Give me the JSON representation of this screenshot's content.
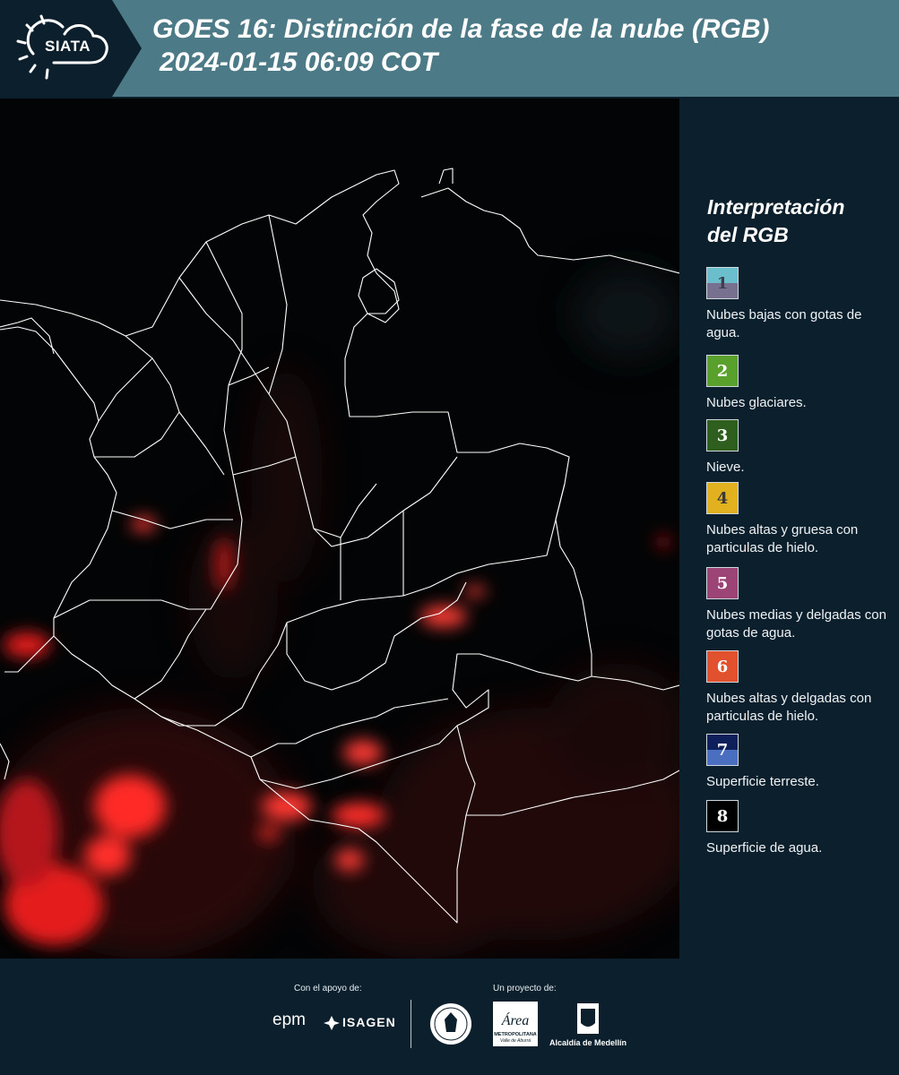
{
  "header": {
    "logo_text": "SIATA",
    "title_line1": "GOES 16: Distinción de la fase de la nube (RGB)",
    "title_line2": "2024-01-15 06:09 COT",
    "color": "#4d7a87"
  },
  "legend": {
    "title_line1": "Interpretación",
    "title_line2": "del RGB",
    "items": [
      {
        "number": "1",
        "label": "Nubes bajas con gotas de agua.",
        "color_top": "#6bbfcd",
        "color_bottom": "#77718f",
        "num_color": "#3d3f4c"
      },
      {
        "number": "2",
        "label": "Nubes glaciares.",
        "color_top": "#5aa02c",
        "color_bottom": "#5aa02c",
        "num_color": "#ffffff"
      },
      {
        "number": "3",
        "label": "Nieve.",
        "color_top": "#2f5f1e",
        "color_bottom": "#2f5f1e",
        "num_color": "#ffffff"
      },
      {
        "number": "4",
        "label": "Nubes altas y gruesa con particulas de hielo.",
        "color_top": "#e2b11f",
        "color_bottom": "#e2b11f",
        "num_color": "#3a3a3a"
      },
      {
        "number": "5",
        "label": "Nubes medias y delgadas con gotas de agua.",
        "color_top": "#9d4477",
        "color_bottom": "#9d4477",
        "num_color": "#ffffff"
      },
      {
        "number": "6",
        "label": "Nubes altas y delgadas con particulas de hielo.",
        "color_top": "#e2512d",
        "color_bottom": "#e2512d",
        "num_color": "#ffffff"
      },
      {
        "number": "7",
        "label": "Superficie terreste.",
        "color_top": "#0e1f5c",
        "color_bottom": "#4a6fc0",
        "num_color": "#ffffff"
      },
      {
        "number": "8",
        "label": "Superficie de agua.",
        "color_top": "#000000",
        "color_bottom": "#000000",
        "num_color": "#ffffff"
      }
    ]
  },
  "footer": {
    "support_label": "Con el apoyo de:",
    "project_label": "Un proyecto de:",
    "epm": "epm",
    "isagen": "ISAGEN",
    "area_line1": "Área",
    "area_line2": "METROPOLITANA",
    "area_line3": "Valle de Aburrá",
    "alcaldia": "Alcaldía de Medellín"
  }
}
